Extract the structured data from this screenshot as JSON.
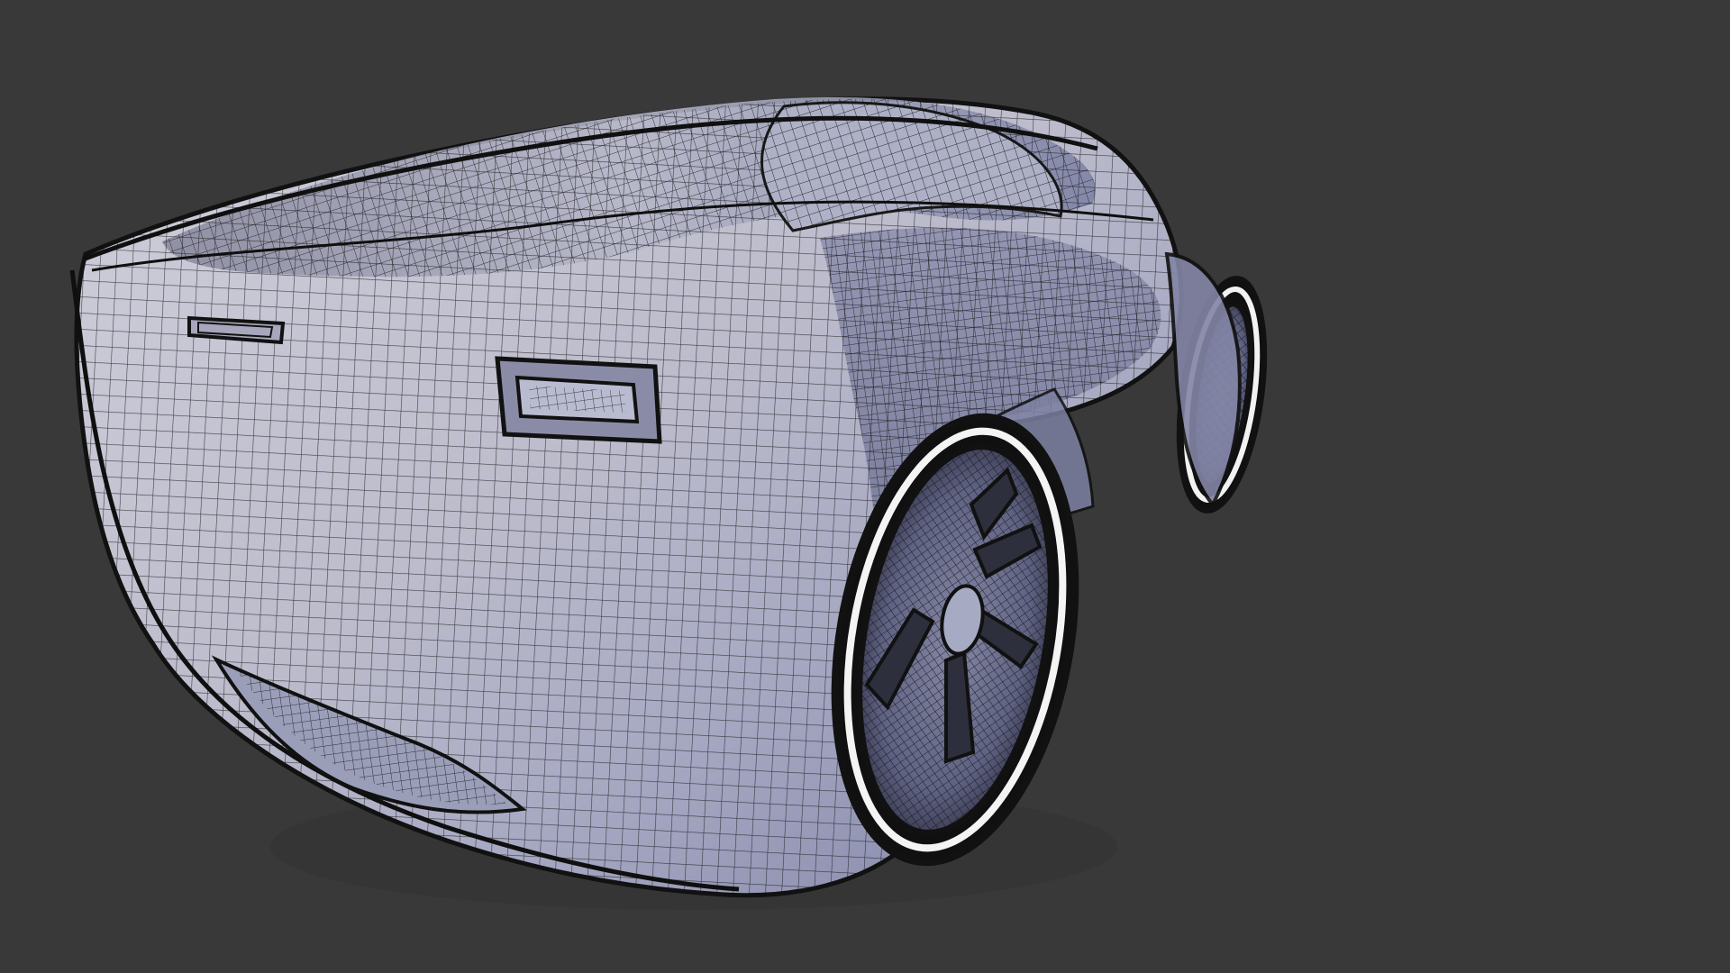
{
  "viewport": {
    "background": "#393939",
    "display_mode": "wireframe-shaded",
    "model": "car-body-mesh"
  },
  "mesh_colors": {
    "body_light": "#c7c7d4",
    "body_mid": "#a8a9c3",
    "body_dark": "#7c7ea3",
    "wire": "#111111",
    "rim_highlight": "#f3f3f3",
    "tire": "#101010"
  }
}
